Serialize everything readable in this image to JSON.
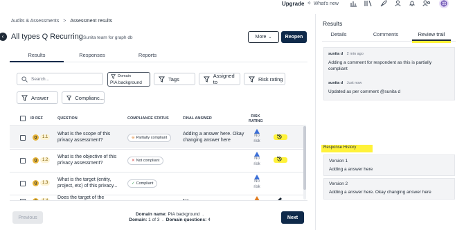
{
  "topbar": {
    "upgrade": "Upgrade",
    "whats_new": "What's new"
  },
  "breadcrumb": {
    "parent": "Audits & Assessments",
    "separator": ">",
    "current": "Assessment results"
  },
  "header": {
    "title": "All types Q Recurring",
    "subtitle": "Sunita team for graph db",
    "more": "More",
    "reopen": "Reopen"
  },
  "tabs": [
    "Results",
    "Responses",
    "Reports"
  ],
  "search": {
    "placeholder": "Search..."
  },
  "filters": {
    "domain_label": "Domain",
    "domain_value": "PIA background",
    "tags": "Tags",
    "assigned_to": "Assigned to",
    "risk_rating": "Risk rating",
    "answer": "Answer",
    "compliance": "Complianc..."
  },
  "table": {
    "headers": {
      "id": "ID REF",
      "question": "QUESTION",
      "status": "COMPLIANCE STATUS",
      "answer": "FINAL ANSWER",
      "risk": "RISK RATING"
    },
    "rows": [
      {
        "badge": "Q",
        "id": "1.1",
        "question": "What is the scope of this privacy assessment?",
        "status": "Partially compliant",
        "answer": "Adding a answer here. Okay changing answer here",
        "risk": "No risk"
      },
      {
        "badge": "Q",
        "id": "1.2",
        "question": "What is the objective of this privacy assessment?",
        "status": "Not compliant",
        "answer": "",
        "risk": "No risk"
      },
      {
        "badge": "Q",
        "id": "1.3",
        "question": "What is the target (entity, project, etc) of this privacy...",
        "status": "Compliant",
        "answer": "",
        "risk": "No risk"
      },
      {
        "badge": "Q",
        "id": "1.4",
        "question": "Does the target of the",
        "status": "",
        "answer": "No",
        "risk": ""
      }
    ]
  },
  "footer": {
    "previous": "Previous",
    "next": "Next",
    "domain_name_label": "Domain name:",
    "domain_name_value": "PIA background",
    "domain_label": "Domain:",
    "domain_value": "1 of 3",
    "questions_label": "Domain questions:",
    "questions_value": "4"
  },
  "right_panel": {
    "title": "Results",
    "tabs": [
      "Details",
      "Comments",
      "Review trail"
    ],
    "comments": [
      {
        "author": "sunita d",
        "time": "2 min ago",
        "text": "Adding a comment for respondent as this is partially compliant"
      },
      {
        "author": "sunita d",
        "time": "Just now",
        "text": "Updated as per comment @sunita d"
      }
    ],
    "history_title": "Response History",
    "versions": [
      {
        "label": "Version 1",
        "text": "Adding a answer here"
      },
      {
        "label": "Version 2",
        "text": "Adding a answer here. Okay changing answer here"
      }
    ]
  },
  "colors": {
    "primary_dark": "#0f2a4a",
    "highlight": "#fff23a",
    "badge": "#e8b53a",
    "risk_blue": "#3b6fd8",
    "risk_orange": "#e07b1f"
  }
}
